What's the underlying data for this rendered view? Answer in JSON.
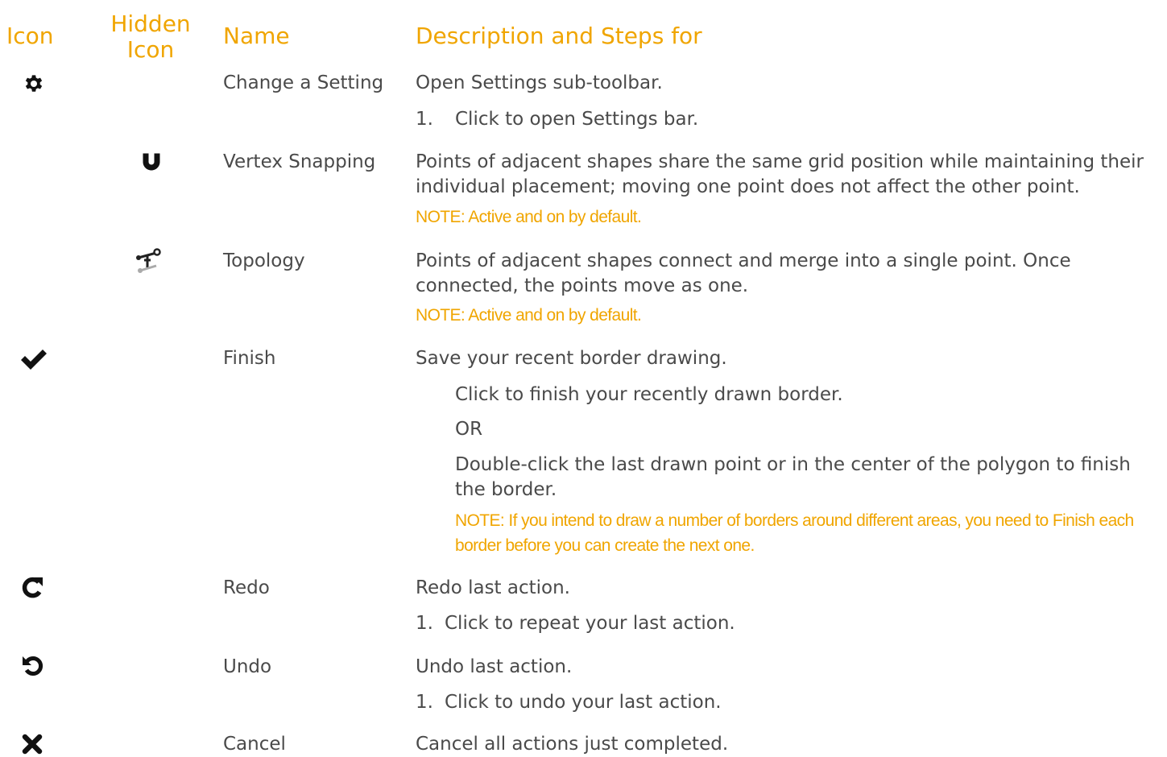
{
  "headers": {
    "icon": "Icon",
    "hidden_icon_line1": "Hidden",
    "hidden_icon_line2": "Icon",
    "name": "Name",
    "description": "Description and Steps for"
  },
  "colors": {
    "accent": "#f0a500",
    "text": "#4a4a4a",
    "icon": "#111111"
  },
  "rows": {
    "settings": {
      "icon": "gear-icon",
      "name": "Change a Setting",
      "description": "Open Settings sub-toolbar.",
      "step_number": "1.",
      "step": "Click to open Settings bar."
    },
    "vertex": {
      "hidden_icon": "magnet-icon",
      "name": "Vertex Snapping",
      "description": "Points of adjacent shapes share the same grid position while maintaining their individual placement; moving one point does not affect the other point.",
      "note": "NOTE: Active and on by default."
    },
    "topology": {
      "hidden_icon": "topology-icon",
      "name": "Topology",
      "description": "Points of adjacent shapes connect and merge into a single point. Once connected, the points move as one.",
      "note": "NOTE: Active and on by default."
    },
    "finish": {
      "icon": "checkmark-icon",
      "name": "Finish",
      "description": "Save your recent border drawing.",
      "step1": "Click to finish your recently drawn border.",
      "or": "OR",
      "step2": "Double-click the last drawn point or in the center of the polygon to finish the border.",
      "note": "NOTE: If you intend to draw a number of borders around different areas, you need to Finish each border before you can create the next one."
    },
    "redo": {
      "icon": "redo-icon",
      "name": "Redo",
      "description": "Redo last action.",
      "step_number": "1.",
      "step": "Click to repeat your last action."
    },
    "undo": {
      "icon": "undo-icon",
      "name": "Undo",
      "description": "Undo last action.",
      "step_number": "1.",
      "step": "Click to undo your last action."
    },
    "cancel": {
      "icon": "close-icon",
      "name": "Cancel",
      "description": "Cancel all actions just completed."
    }
  }
}
